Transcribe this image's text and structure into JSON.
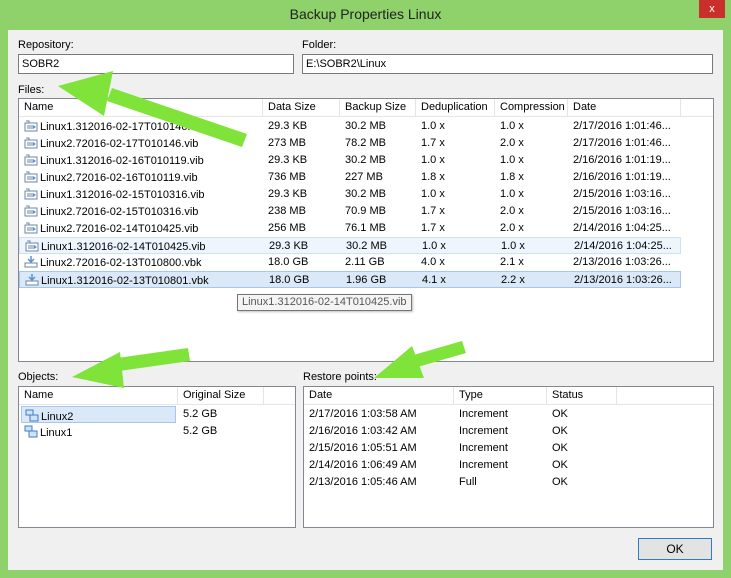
{
  "window": {
    "title": "Backup Properties Linux",
    "close_glyph": "x"
  },
  "repository": {
    "label": "Repository:",
    "value": "SOBR2"
  },
  "folder": {
    "label": "Folder:",
    "value": "E:\\SOBR2\\Linux"
  },
  "files": {
    "label": "Files:",
    "columns": [
      "Name",
      "Data Size",
      "Backup Size",
      "Deduplication",
      "Compression",
      "Date"
    ],
    "rows": [
      {
        "icon": "vib-file-icon",
        "name": "Linux1.312016-02-17T010146.vib",
        "data_size": "29.3 KB",
        "backup_size": "30.2 MB",
        "dedup": "1.0 x",
        "compression": "1.0 x",
        "date": "2/17/2016 1:01:46..."
      },
      {
        "icon": "vib-file-icon",
        "name": "Linux2.72016-02-17T010146.vib",
        "data_size": "273 MB",
        "backup_size": "78.2 MB",
        "dedup": "1.7 x",
        "compression": "2.0 x",
        "date": "2/17/2016 1:01:46..."
      },
      {
        "icon": "vib-file-icon",
        "name": "Linux1.312016-02-16T010119.vib",
        "data_size": "29.3 KB",
        "backup_size": "30.2 MB",
        "dedup": "1.0 x",
        "compression": "1.0 x",
        "date": "2/16/2016 1:01:19..."
      },
      {
        "icon": "vib-file-icon",
        "name": "Linux2.72016-02-16T010119.vib",
        "data_size": "736 MB",
        "backup_size": "227 MB",
        "dedup": "1.8 x",
        "compression": "1.8 x",
        "date": "2/16/2016 1:01:19..."
      },
      {
        "icon": "vib-file-icon",
        "name": "Linux1.312016-02-15T010316.vib",
        "data_size": "29.3 KB",
        "backup_size": "30.2 MB",
        "dedup": "1.0 x",
        "compression": "1.0 x",
        "date": "2/15/2016 1:03:16..."
      },
      {
        "icon": "vib-file-icon",
        "name": "Linux2.72016-02-15T010316.vib",
        "data_size": "238 MB",
        "backup_size": "70.9 MB",
        "dedup": "1.7 x",
        "compression": "2.0 x",
        "date": "2/15/2016 1:03:16..."
      },
      {
        "icon": "vib-file-icon",
        "name": "Linux2.72016-02-14T010425.vib",
        "data_size": "256 MB",
        "backup_size": "76.1 MB",
        "dedup": "1.7 x",
        "compression": "2.0 x",
        "date": "2/14/2016 1:04:25..."
      },
      {
        "icon": "vib-file-icon",
        "name": "Linux1.312016-02-14T010425.vib",
        "data_size": "29.3 KB",
        "backup_size": "30.2 MB",
        "dedup": "1.0 x",
        "compression": "1.0 x",
        "date": "2/14/2016 1:04:25..."
      },
      {
        "icon": "vbk-file-icon",
        "name": "Linux2.72016-02-13T010800.vbk",
        "data_size": "18.0 GB",
        "backup_size": "2.11 GB",
        "dedup": "4.0 x",
        "compression": "2.1 x",
        "date": "2/13/2016 1:03:26..."
      },
      {
        "icon": "vbk-file-icon",
        "name": "Linux1.312016-02-13T010801.vbk",
        "data_size": "18.0 GB",
        "backup_size": "1.96 GB",
        "dedup": "4.1 x",
        "compression": "2.2 x",
        "date": "2/13/2016 1:03:26..."
      }
    ],
    "tooltip": "Linux1.312016-02-14T010425.vib"
  },
  "objects": {
    "label": "Objects:",
    "columns": [
      "Name",
      "Original Size"
    ],
    "rows": [
      {
        "name": "Linux2",
        "size": "5.2 GB"
      },
      {
        "name": "Linux1",
        "size": "5.2 GB"
      }
    ]
  },
  "restore_points": {
    "label": "Restore points:",
    "columns": [
      "Date",
      "Type",
      "Status"
    ],
    "rows": [
      {
        "date": "2/17/2016 1:03:58 AM",
        "type": "Increment",
        "status": "OK"
      },
      {
        "date": "2/16/2016 1:03:42 AM",
        "type": "Increment",
        "status": "OK"
      },
      {
        "date": "2/15/2016 1:05:51 AM",
        "type": "Increment",
        "status": "OK"
      },
      {
        "date": "2/14/2016 1:06:49 AM",
        "type": "Increment",
        "status": "OK"
      },
      {
        "date": "2/13/2016 1:05:46 AM",
        "type": "Full",
        "status": "OK"
      }
    ]
  },
  "ok_button": {
    "label": "OK"
  },
  "colors": {
    "window_chrome": "#8fd16a",
    "close_button": "#c9302c",
    "selection": "#dbe8f7",
    "annotation_arrow": "#7fe33a"
  }
}
